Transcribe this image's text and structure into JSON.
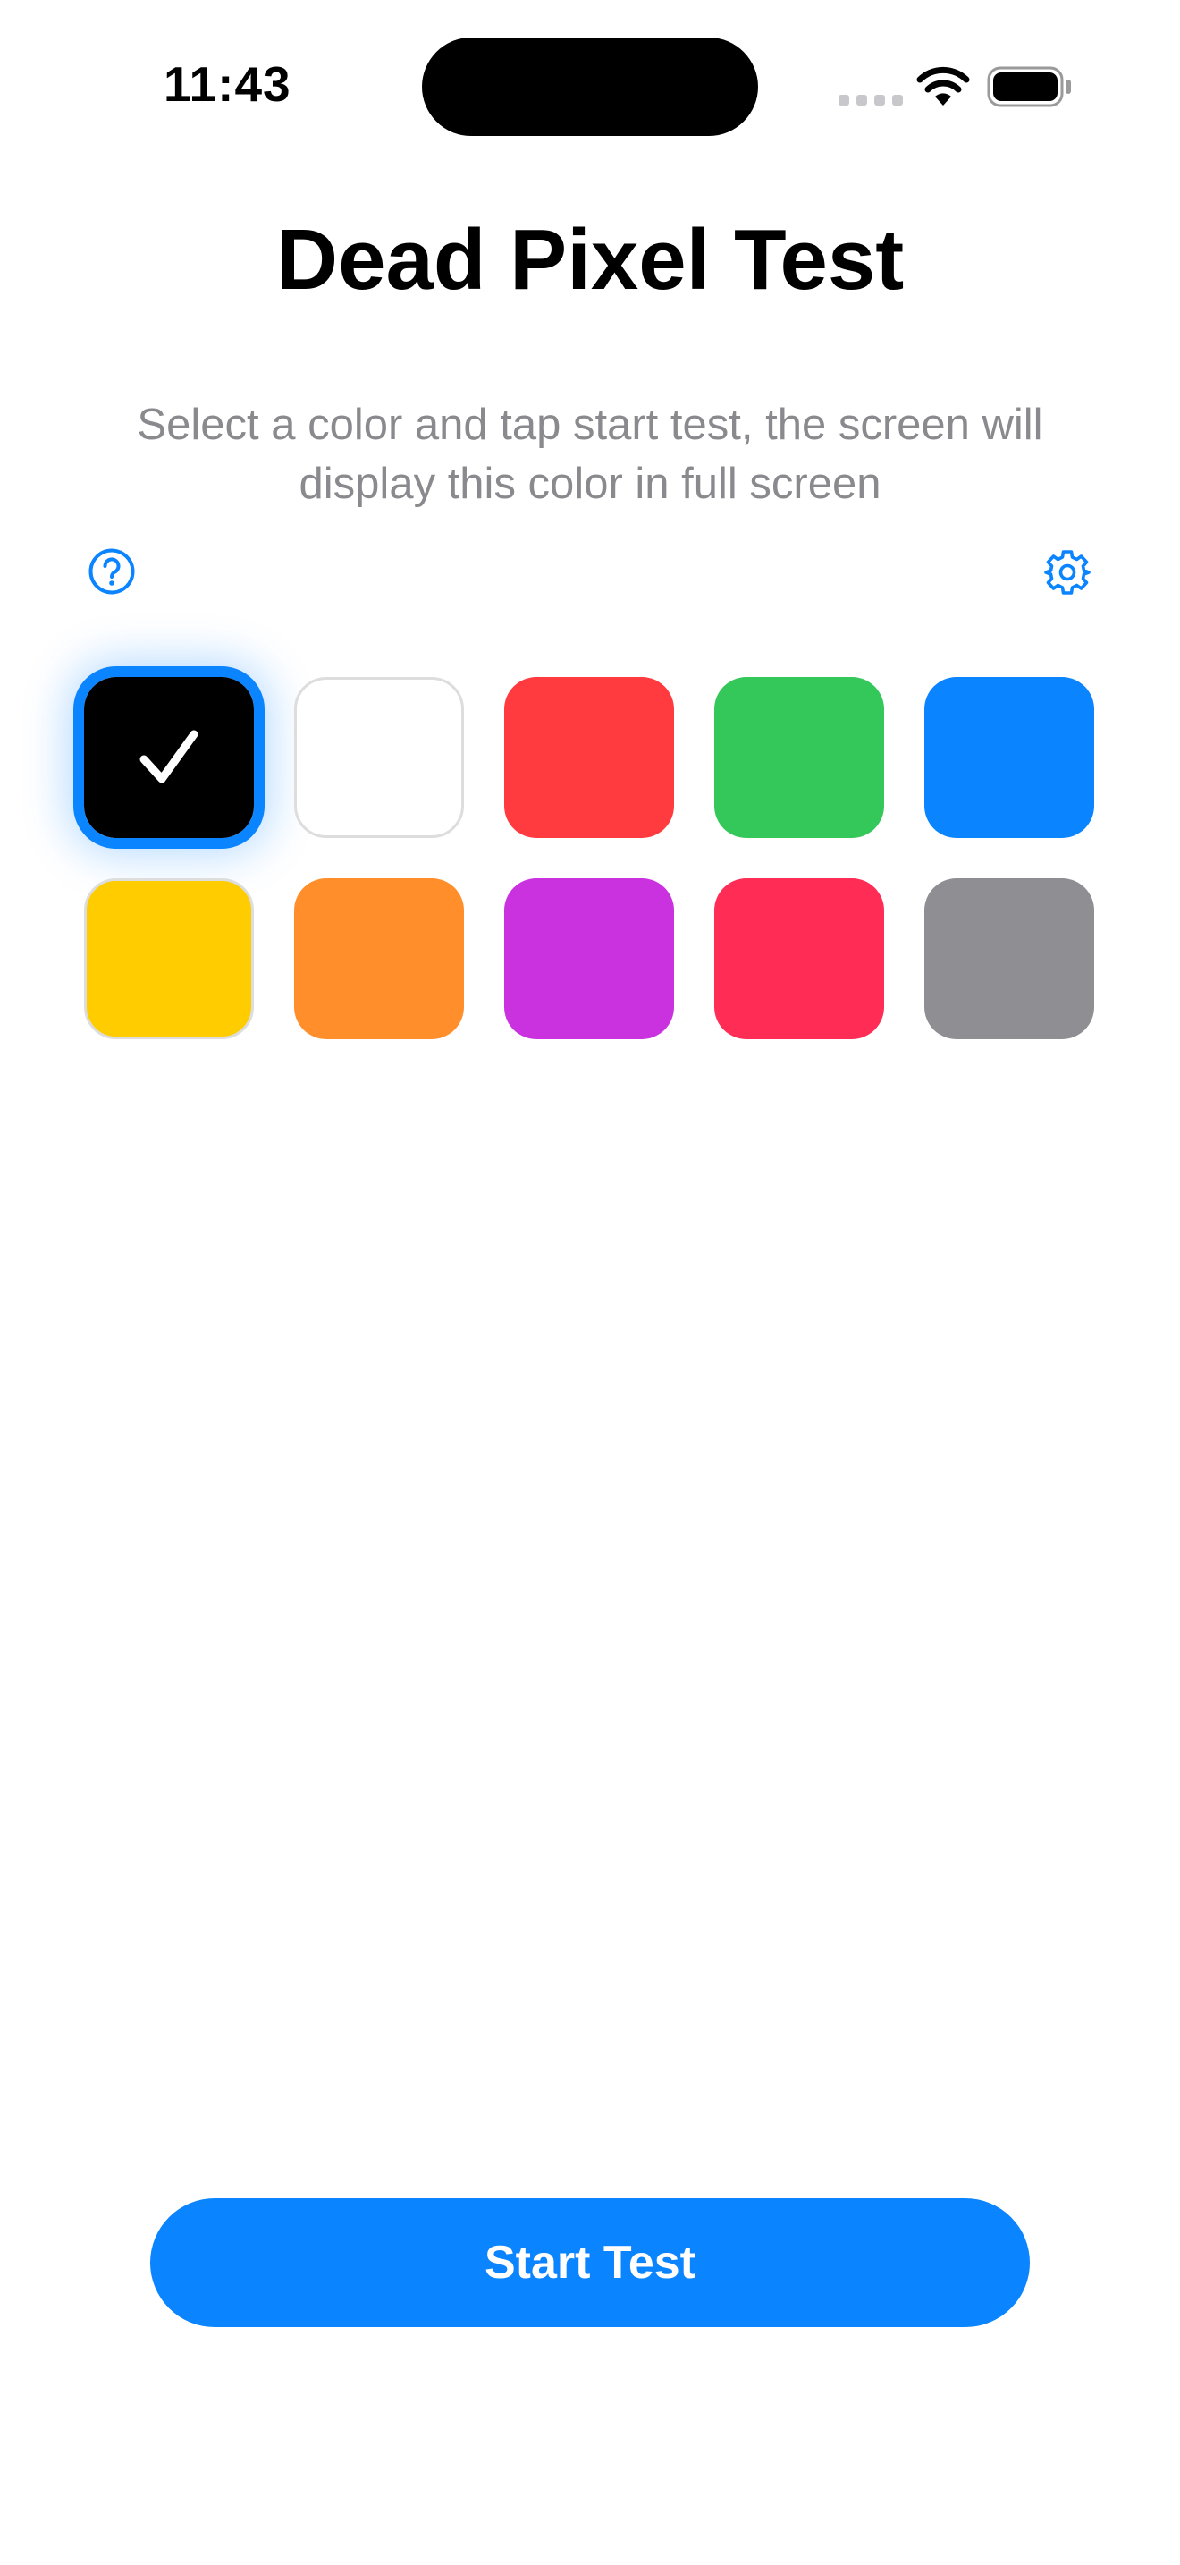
{
  "status_bar": {
    "time": "11:43"
  },
  "header": {
    "title": "Dead Pixel Test",
    "instructions": "Select a color and tap start test, the screen will display this color in full screen"
  },
  "toolbar": {
    "help_icon": "question-circle-icon",
    "settings_icon": "gear-icon"
  },
  "accent_color": "#0A84FF",
  "colors": {
    "selected_index": 0,
    "swatches": [
      {
        "name": "black",
        "hex": "#000000"
      },
      {
        "name": "white",
        "hex": "#FFFFFF"
      },
      {
        "name": "red",
        "hex": "#FF3B3F"
      },
      {
        "name": "green",
        "hex": "#34C759"
      },
      {
        "name": "blue",
        "hex": "#0A84FF"
      },
      {
        "name": "yellow",
        "hex": "#FFCC00"
      },
      {
        "name": "orange",
        "hex": "#FF8E2B"
      },
      {
        "name": "purple",
        "hex": "#CA32E0"
      },
      {
        "name": "pink",
        "hex": "#FF2D55"
      },
      {
        "name": "gray",
        "hex": "#8E8E93"
      }
    ]
  },
  "actions": {
    "start_label": "Start Test"
  }
}
